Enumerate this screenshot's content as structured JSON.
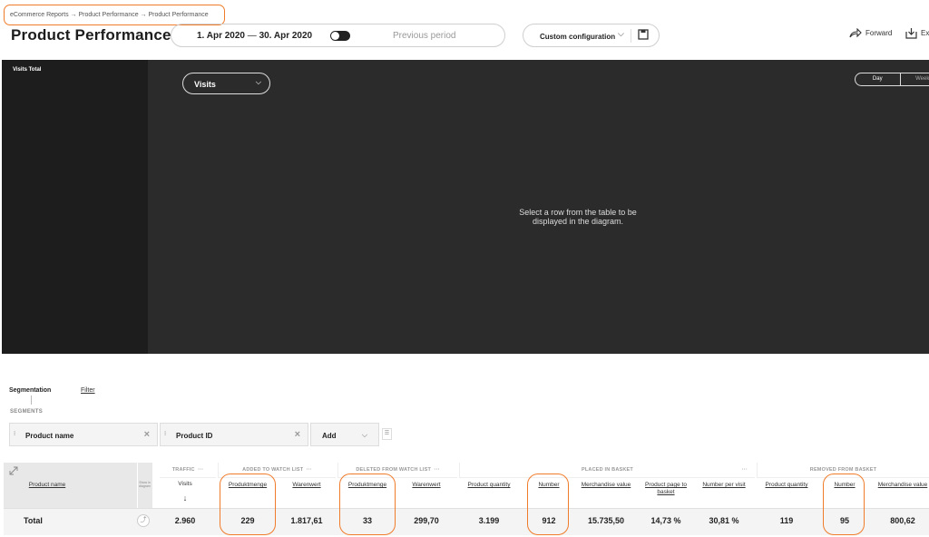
{
  "breadcrumb": "eCommerce Reports → Product Performance → Product Performance",
  "page_title": "Product Performance",
  "period": {
    "start": "1. Apr 2020",
    "dash": "—",
    "end": "30. Apr 2020",
    "previous_label": "Previous period"
  },
  "config": {
    "label": "Custom configuration"
  },
  "actions": {
    "forward": "Forward",
    "export": "Ex"
  },
  "chart": {
    "side_label": "Visits Total",
    "metric_select": "Visits",
    "granularity": [
      "Day",
      "Week"
    ],
    "empty_message": "Select a row from the table to be displayed in the diagram."
  },
  "segmentation": {
    "tab_segmentation": "Segmentation",
    "tab_filter": "Filter",
    "segments_label": "SEGMENTS",
    "chips": [
      "Product name",
      "Product ID"
    ],
    "add_label": "Add"
  },
  "table": {
    "groups": [
      "TRAFFIC",
      "ADDED TO WATCH LIST",
      "DELETED FROM WATCH LIST",
      "PLACED IN BASKET",
      "REMOVED FROM BASKET"
    ],
    "first_col": "Product name",
    "show_in_diagram": "Show in diagram",
    "sort_indicator": "↓",
    "headers": [
      "Visits",
      "Produktmenge",
      "Warenwert",
      "Produktmenge",
      "Warenwert",
      "Product quantity",
      "Number",
      "Merchandise value",
      "Product page to basket",
      "Number per visit",
      "Product quantity",
      "Number",
      "Merchandise value"
    ],
    "total_label": "Total",
    "total_values": [
      "2.960",
      "229",
      "1.817,61",
      "33",
      "299,70",
      "3.199",
      "912",
      "15.735,50",
      "14,73 %",
      "30,81 %",
      "119",
      "95",
      "800,62"
    ]
  },
  "colors": {
    "highlight": "#f07c2b",
    "chart_bg": "#2b2b2b"
  }
}
